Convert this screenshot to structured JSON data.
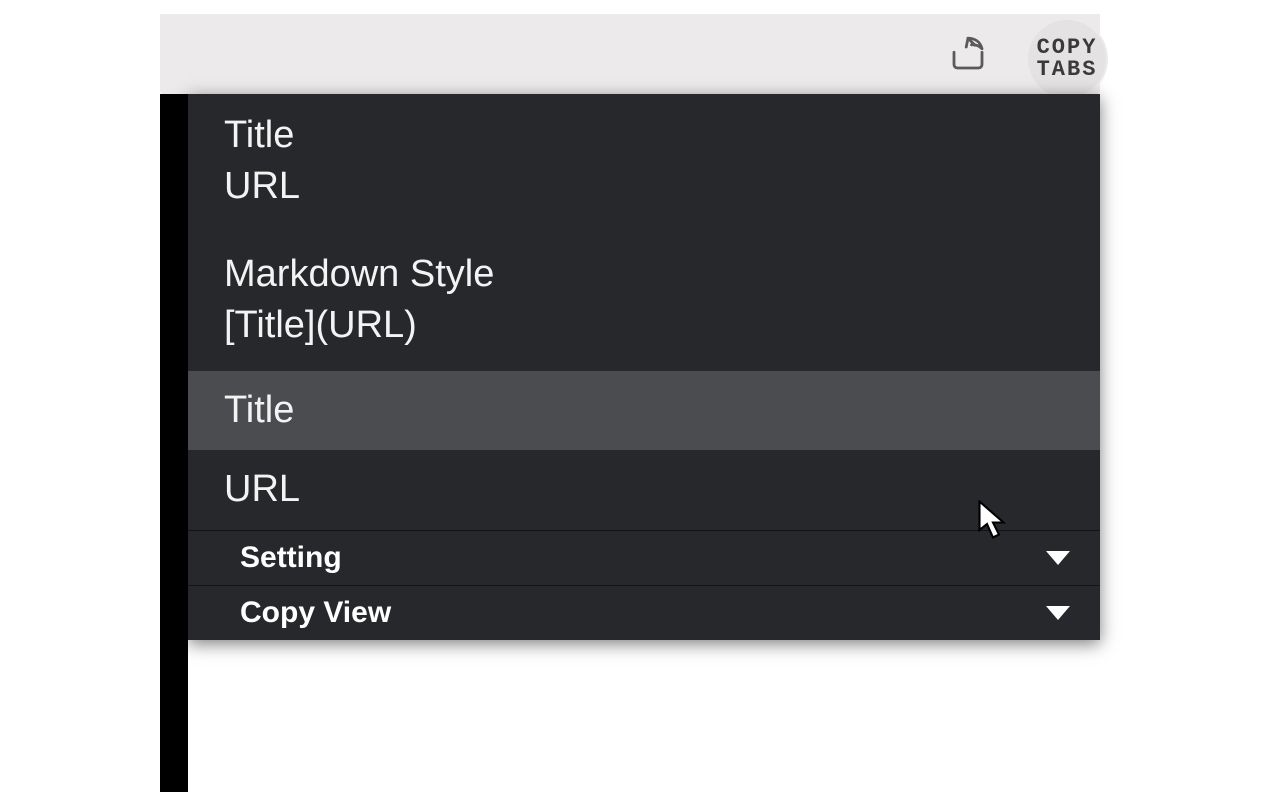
{
  "toolbar": {
    "share_icon": "share-icon",
    "star_icon": "star-icon",
    "extension_label": "COPY\nTABS"
  },
  "popup": {
    "groups": [
      {
        "lines": [
          "Title",
          "URL"
        ]
      },
      {
        "lines": [
          "Markdown Style",
          "[Title](URL)"
        ]
      }
    ],
    "items": [
      {
        "label": "Title",
        "hover": true
      },
      {
        "label": "URL",
        "hover": false
      }
    ],
    "sections": [
      {
        "label": "Setting"
      },
      {
        "label": "Copy View"
      }
    ]
  }
}
